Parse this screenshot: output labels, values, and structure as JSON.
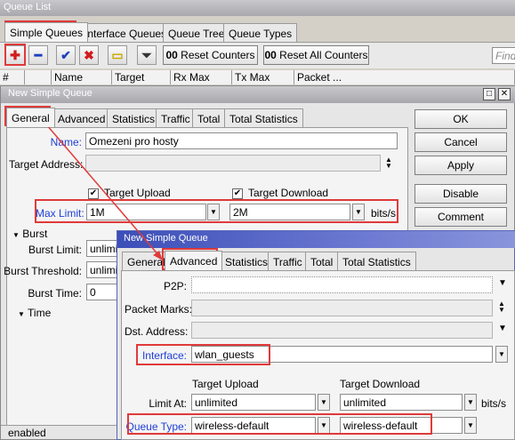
{
  "queue_list": {
    "title": "Queue List",
    "tabs": [
      "Simple Queues",
      "Interface Queues",
      "Queue Tree",
      "Queue Types"
    ],
    "toolbar": {
      "reset_counters": "Reset Counters",
      "reset_all_counters": "Reset All Counters",
      "find_placeholder": "Find",
      "oo": "00"
    },
    "columns": [
      "#",
      "Name",
      "Target Ad...",
      "Rx Max Limit",
      "Tx Max Limit",
      "Packet ..."
    ],
    "status": "enabled"
  },
  "dialog1": {
    "title": "New Simple Queue",
    "tabs": [
      "General",
      "Advanced",
      "Statistics",
      "Traffic",
      "Total",
      "Total Statistics"
    ],
    "name_label": "Name:",
    "name_value": "Omezeni pro hosty",
    "target_address_label": "Target Address:",
    "target_upload_label": "Target Upload",
    "target_download_label": "Target Download",
    "max_limit_label": "Max Limit:",
    "max_limit_upload": "1M",
    "max_limit_download": "2M",
    "unit": "bits/s",
    "burst_label": "Burst",
    "burst_limit_label": "Burst Limit:",
    "burst_limit_value": "unlimi",
    "burst_threshold_label": "Burst Threshold:",
    "burst_threshold_value": "unlimi",
    "burst_time_label": "Burst Time:",
    "burst_time_value": "0",
    "time_label": "Time",
    "buttons": {
      "ok": "OK",
      "cancel": "Cancel",
      "apply": "Apply",
      "disable": "Disable",
      "comment": "Comment"
    }
  },
  "dialog2": {
    "title": "New Simple Queue",
    "tabs": [
      "General",
      "Advanced",
      "Statistics",
      "Traffic",
      "Total",
      "Total Statistics"
    ],
    "p2p_label": "P2P:",
    "packet_marks_label": "Packet Marks:",
    "dst_address_label": "Dst. Address:",
    "interface_label": "Interface:",
    "interface_value": "wlan_guests",
    "target_upload_label": "Target Upload",
    "target_download_label": "Target Download",
    "limit_at_label": "Limit At:",
    "limit_at_upload": "unlimited",
    "limit_at_download": "unlimited",
    "unit": "bits/s",
    "queue_type_label": "Queue Type:",
    "queue_type_upload": "wireless-default",
    "queue_type_download": "wireless-default"
  },
  "colors": {
    "highlight": "#e03a3a",
    "link": "#1e3fd6",
    "title_blue": "#3c4fb8"
  }
}
